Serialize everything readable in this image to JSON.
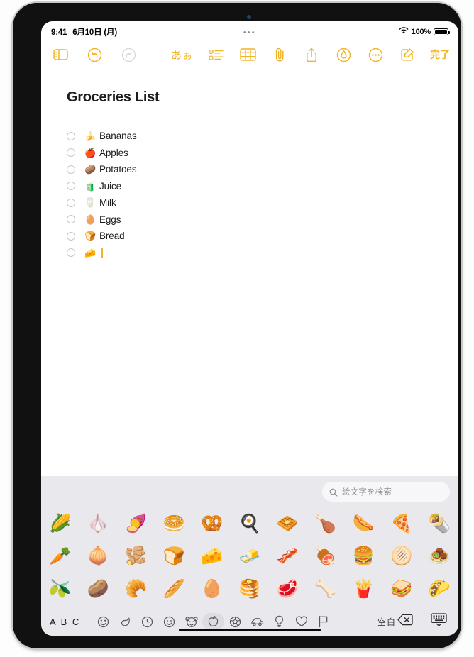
{
  "device": {
    "name": "ipad-tablet"
  },
  "status_bar": {
    "time": "9:41",
    "date": "6月10日 (月)",
    "center_dots": "•••",
    "wifi_icon": "wifi-icon",
    "battery_percent": "100%",
    "battery_icon": "battery-full-icon"
  },
  "toolbar": {
    "left": [
      {
        "name": "sidebar-toggle-button",
        "icon": "sidebar-icon",
        "state": "enabled"
      },
      {
        "name": "undo-button",
        "icon": "undo-arrow-icon",
        "state": "enabled"
      },
      {
        "name": "redo-button",
        "icon": "redo-arrow-icon",
        "state": "disabled"
      }
    ],
    "format_label": "あぁ",
    "right": [
      {
        "name": "format-button",
        "icon": "text-format-icon"
      },
      {
        "name": "checklist-button",
        "icon": "checklist-icon"
      },
      {
        "name": "table-button",
        "icon": "table-icon"
      },
      {
        "name": "attach-button",
        "icon": "paperclip-icon"
      },
      {
        "name": "share-button",
        "icon": "share-icon"
      },
      {
        "name": "markup-button",
        "icon": "markup-pen-icon"
      },
      {
        "name": "more-button",
        "icon": "ellipsis-circle-icon"
      },
      {
        "name": "compose-button",
        "icon": "compose-pencil-icon"
      }
    ],
    "done_label": "完了",
    "accent_color": "#f0b429"
  },
  "note": {
    "title": "Groceries List",
    "checklist": [
      {
        "emoji": "🍌",
        "text": "Bananas",
        "checked": false
      },
      {
        "emoji": "🍎",
        "text": "Apples",
        "checked": false
      },
      {
        "emoji": "🥔",
        "text": "Potatoes",
        "checked": false
      },
      {
        "emoji": "🧃",
        "text": "Juice",
        "checked": false
      },
      {
        "emoji": "🥛",
        "text": "Milk",
        "checked": false
      },
      {
        "emoji": "🥚",
        "text": "Eggs",
        "checked": false
      },
      {
        "emoji": "🍞",
        "text": "Bread",
        "checked": false
      },
      {
        "emoji": "🧀",
        "text": "",
        "checked": false,
        "cursor": true
      }
    ]
  },
  "keyboard": {
    "search_placeholder": "絵文字を検索",
    "search_icon": "magnifier-icon",
    "emoji_rows": [
      [
        "🌽",
        "🧄",
        "🍠",
        "🥯",
        "🥨",
        "🍳",
        "🧇",
        "🍗",
        "🌭",
        "🍕",
        "🌯"
      ],
      [
        "🥕",
        "🧅",
        "🫚",
        "🍞",
        "🧀",
        "🧈",
        "🥓",
        "🍖",
        "🍔",
        "🫓",
        "🧆"
      ],
      [
        "🫒",
        "🥔",
        "🥐",
        "🥖",
        "🥚",
        "🥞",
        "🥩",
        "🦴",
        "🍟",
        "🥪",
        "🌮"
      ]
    ],
    "abc_label": "A B C",
    "space_label": "空白",
    "categories": [
      {
        "name": "category-recents",
        "icon": "clock-face-icon",
        "selected": false
      },
      {
        "name": "category-frequent",
        "icon": "leaf-shape-icon",
        "selected": false
      },
      {
        "name": "category-clock",
        "icon": "clock-icon",
        "selected": false
      },
      {
        "name": "category-smileys",
        "icon": "smiley-face-icon",
        "selected": false
      },
      {
        "name": "category-animals",
        "icon": "animal-paw-icon",
        "selected": false
      },
      {
        "name": "category-food",
        "icon": "apple-icon",
        "selected": true
      },
      {
        "name": "category-activity",
        "icon": "ball-icon",
        "selected": false
      },
      {
        "name": "category-travel",
        "icon": "car-icon",
        "selected": false
      },
      {
        "name": "category-objects",
        "icon": "lightbulb-icon",
        "selected": false
      },
      {
        "name": "category-symbols",
        "icon": "heart-icon",
        "selected": false
      },
      {
        "name": "category-flags",
        "icon": "flag-icon",
        "selected": false
      }
    ],
    "delete_icon": "delete-backward-icon",
    "dismiss_icon": "dismiss-keyboard-icon"
  }
}
